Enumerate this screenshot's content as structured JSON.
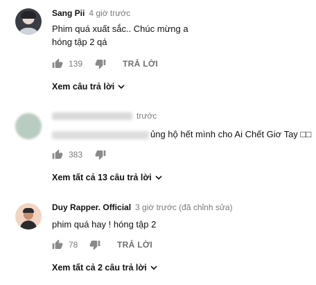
{
  "comments": [
    {
      "author": "Sang Pii",
      "time": "4 giờ trước",
      "lines": [
        "Phim quá xuất sắc.. Chúc mừng a",
        "hóng tập 2 qá"
      ],
      "likes": "139",
      "reply_label": "TRẢ LỜI",
      "replies_toggle": "Xem câu trả lời"
    },
    {
      "author": "",
      "time": "trước",
      "text_visible": "ủng hộ hết mình cho Ai Chết Giơ Tay □□",
      "likes": "383",
      "replies_toggle": "Xem tất cả 13 câu trả lời"
    },
    {
      "author": "Duy Rapper. Official",
      "time": "3 giờ trước (đã chỉnh sửa)",
      "text": "phim quá hay ! hóng tập 2",
      "likes": "78",
      "reply_label": "TRẢ LỜI",
      "replies_toggle": "Xem tất cả 2 câu trả lời"
    }
  ],
  "colors": {
    "muted": "#7a7a7a",
    "text": "#111111",
    "icon": "#8a8a8a"
  }
}
